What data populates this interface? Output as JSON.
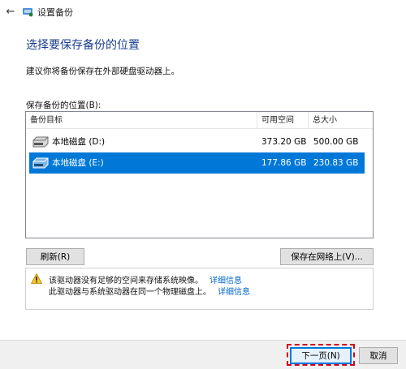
{
  "window": {
    "title": "设置备份"
  },
  "header": {
    "heading": "选择要保存备份的位置"
  },
  "instruction": "建议你将备份保存在外部硬盘驱动器上。",
  "list": {
    "label": "保存备份的位置(B):",
    "columns": [
      "备份目标",
      "可用空间",
      "总大小"
    ],
    "rows": [
      {
        "name": "本地磁盘 (D:)",
        "free": "373.20 GB",
        "total": "500.00 GB",
        "selected": false
      },
      {
        "name": "本地磁盘 (E:)",
        "free": "177.86 GB",
        "total": "230.83 GB",
        "selected": true
      }
    ]
  },
  "buttons": {
    "refresh": "刷新(R)",
    "save_network": "保存在网络上(V)...",
    "next": "下一页(N)",
    "cancel": "取消"
  },
  "warning": {
    "line1": "该驱动器没有足够的空间来存储系统映像。",
    "line1_link": "详细信息",
    "line2": "此驱动器与系统驱动器在同一个物理磁盘上。",
    "line2_link": "详细信息"
  },
  "icons": {
    "back": "back-arrow-icon",
    "app": "backup-app-icon",
    "drive": "hard-drive-icon",
    "warning": "warning-icon"
  },
  "colors": {
    "accent": "#0078d7",
    "heading": "#1a3d8f",
    "link": "#0066cc",
    "highlight": "#d0021b"
  }
}
